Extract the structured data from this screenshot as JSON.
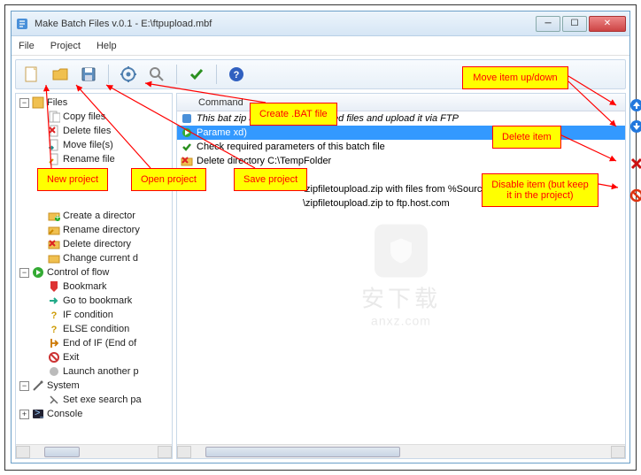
{
  "window": {
    "title": "Make Batch Files v.0.1 - E:\\ftpupload.mbf"
  },
  "menu": {
    "file": "File",
    "project": "Project",
    "help": "Help"
  },
  "tree": {
    "root0": "Files",
    "items0": [
      "Copy files",
      "Delete files",
      "Move file(s)",
      "Rename file"
    ],
    "items0b": [
      "Create a director",
      "Rename directory",
      "Delete directory",
      "Change current d"
    ],
    "root1": "Control of flow",
    "items1": [
      "Bookmark",
      "Go to bookmark",
      "IF condition",
      "ELSE condition",
      "End of IF (End of",
      "Exit",
      "Launch another p"
    ],
    "root2": "System",
    "items2": [
      "Set exe search pa"
    ],
    "root3": "Console"
  },
  "column_header": "Command",
  "commands": {
    "r0": "This bat                                                 zip archive from specified files and upload it via FTP",
    "r1": "Parame                                               xd)",
    "r2": "Check required parameters of this batch file",
    "r3": "Delete directory C:\\TempFolder",
    "r4_b": "\\zipfiletoupload.zip with files from %SourceFiles%",
    "r5_b": "\\zipfiletoupload.zip to ftp.host.com"
  },
  "callouts": {
    "move": "Move item up/down",
    "delete": "Delete item",
    "disable": "Disable item (but keep it in the project)",
    "newproj": "New project",
    "openproj": "Open project",
    "saveproj": "Save project",
    "createbat": "Create .BAT file"
  },
  "watermark": {
    "cn": "安下载",
    "en": "anxz.com"
  }
}
